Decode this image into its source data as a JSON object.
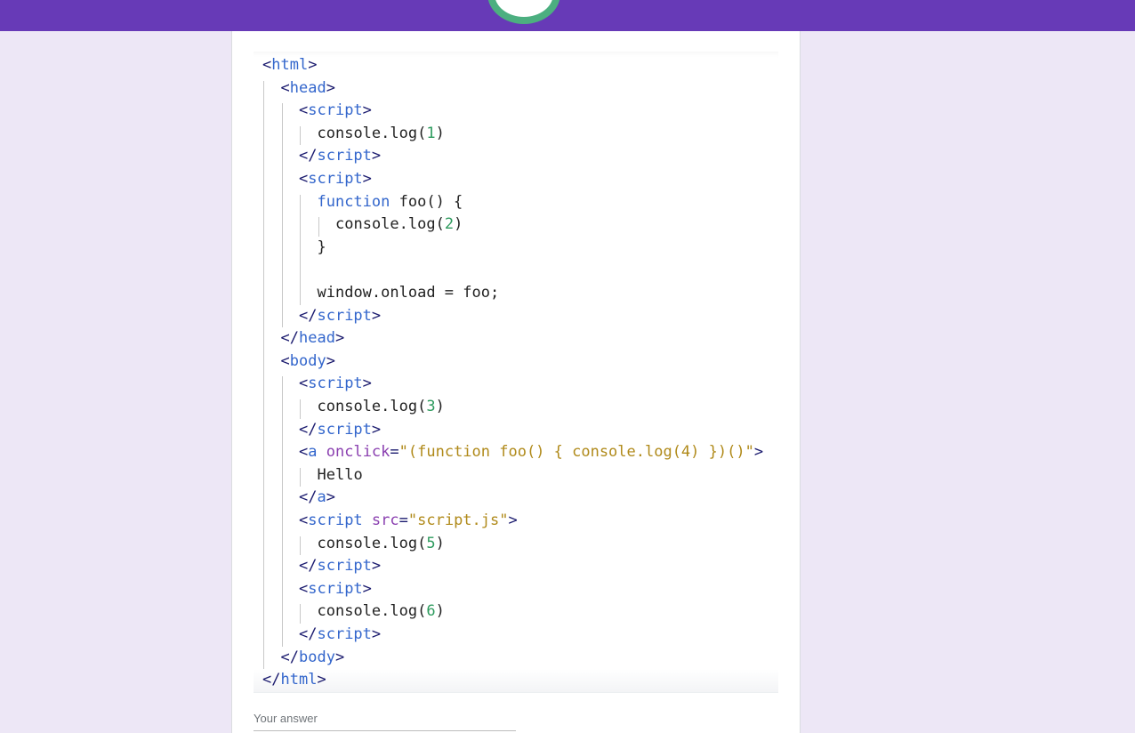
{
  "form": {
    "answer_placeholder": "Your answer"
  },
  "code": {
    "lines": [
      {
        "indent": 0,
        "tokens": [
          [
            "punc",
            "<"
          ],
          [
            "tag",
            "html"
          ],
          [
            "punc",
            ">"
          ]
        ]
      },
      {
        "indent": 1,
        "tokens": [
          [
            "punc",
            "<"
          ],
          [
            "tag",
            "head"
          ],
          [
            "punc",
            ">"
          ]
        ]
      },
      {
        "indent": 2,
        "tokens": [
          [
            "punc",
            "<"
          ],
          [
            "tag",
            "script"
          ],
          [
            "punc",
            ">"
          ]
        ]
      },
      {
        "indent": 3,
        "tokens": [
          [
            "plain",
            "console.log("
          ],
          [
            "num",
            "1"
          ],
          [
            "plain",
            ")"
          ]
        ]
      },
      {
        "indent": 2,
        "tokens": [
          [
            "punc",
            "</"
          ],
          [
            "tag",
            "script"
          ],
          [
            "punc",
            ">"
          ]
        ]
      },
      {
        "indent": 2,
        "tokens": [
          [
            "punc",
            "<"
          ],
          [
            "tag",
            "script"
          ],
          [
            "punc",
            ">"
          ]
        ]
      },
      {
        "indent": 3,
        "tokens": [
          [
            "kw",
            "function"
          ],
          [
            "plain",
            " foo() {"
          ]
        ]
      },
      {
        "indent": 4,
        "tokens": [
          [
            "plain",
            "console.log("
          ],
          [
            "num",
            "2"
          ],
          [
            "plain",
            ")"
          ]
        ]
      },
      {
        "indent": 3,
        "tokens": [
          [
            "plain",
            "}"
          ]
        ]
      },
      {
        "indent": 3,
        "tokens": [
          [
            "plain",
            ""
          ]
        ]
      },
      {
        "indent": 3,
        "tokens": [
          [
            "plain",
            "window.onload = foo;"
          ]
        ]
      },
      {
        "indent": 2,
        "tokens": [
          [
            "punc",
            "</"
          ],
          [
            "tag",
            "script"
          ],
          [
            "punc",
            ">"
          ]
        ]
      },
      {
        "indent": 1,
        "tokens": [
          [
            "punc",
            "</"
          ],
          [
            "tag",
            "head"
          ],
          [
            "punc",
            ">"
          ]
        ]
      },
      {
        "indent": 1,
        "tokens": [
          [
            "punc",
            "<"
          ],
          [
            "tag",
            "body"
          ],
          [
            "punc",
            ">"
          ]
        ]
      },
      {
        "indent": 2,
        "tokens": [
          [
            "punc",
            "<"
          ],
          [
            "tag",
            "script"
          ],
          [
            "punc",
            ">"
          ]
        ]
      },
      {
        "indent": 3,
        "tokens": [
          [
            "plain",
            "console.log("
          ],
          [
            "num",
            "3"
          ],
          [
            "plain",
            ")"
          ]
        ]
      },
      {
        "indent": 2,
        "tokens": [
          [
            "punc",
            "</"
          ],
          [
            "tag",
            "script"
          ],
          [
            "punc",
            ">"
          ]
        ]
      },
      {
        "indent": 2,
        "tokens": [
          [
            "punc",
            "<"
          ],
          [
            "tag",
            "a"
          ],
          [
            "plain",
            " "
          ],
          [
            "attr",
            "onclick"
          ],
          [
            "punc",
            "="
          ],
          [
            "str",
            "\"(function foo() { console.log(4) })()\""
          ],
          [
            "punc",
            ">"
          ]
        ]
      },
      {
        "indent": 3,
        "tokens": [
          [
            "plain",
            "Hello"
          ]
        ]
      },
      {
        "indent": 2,
        "tokens": [
          [
            "punc",
            "</"
          ],
          [
            "tag",
            "a"
          ],
          [
            "punc",
            ">"
          ]
        ]
      },
      {
        "indent": 2,
        "tokens": [
          [
            "punc",
            "<"
          ],
          [
            "tag",
            "script"
          ],
          [
            "plain",
            " "
          ],
          [
            "attr",
            "src"
          ],
          [
            "punc",
            "="
          ],
          [
            "str",
            "\"script.js\""
          ],
          [
            "punc",
            ">"
          ]
        ]
      },
      {
        "indent": 3,
        "tokens": [
          [
            "plain",
            "console.log("
          ],
          [
            "num",
            "5"
          ],
          [
            "plain",
            ")"
          ]
        ]
      },
      {
        "indent": 2,
        "tokens": [
          [
            "punc",
            "</"
          ],
          [
            "tag",
            "script"
          ],
          [
            "punc",
            ">"
          ]
        ]
      },
      {
        "indent": 2,
        "tokens": [
          [
            "punc",
            "<"
          ],
          [
            "tag",
            "script"
          ],
          [
            "punc",
            ">"
          ]
        ]
      },
      {
        "indent": 3,
        "tokens": [
          [
            "plain",
            "console.log("
          ],
          [
            "num",
            "6"
          ],
          [
            "plain",
            ")"
          ]
        ]
      },
      {
        "indent": 2,
        "tokens": [
          [
            "punc",
            "</"
          ],
          [
            "tag",
            "script"
          ],
          [
            "punc",
            ">"
          ]
        ]
      },
      {
        "indent": 1,
        "tokens": [
          [
            "punc",
            "</"
          ],
          [
            "tag",
            "body"
          ],
          [
            "punc",
            ">"
          ]
        ]
      },
      {
        "indent": 0,
        "tokens": [
          [
            "punc",
            "</"
          ],
          [
            "tag",
            "html"
          ],
          [
            "punc",
            ">"
          ]
        ]
      }
    ]
  },
  "colors": {
    "header": "#673ab7",
    "background": "#ede7f6",
    "progress": "#4caf80"
  }
}
